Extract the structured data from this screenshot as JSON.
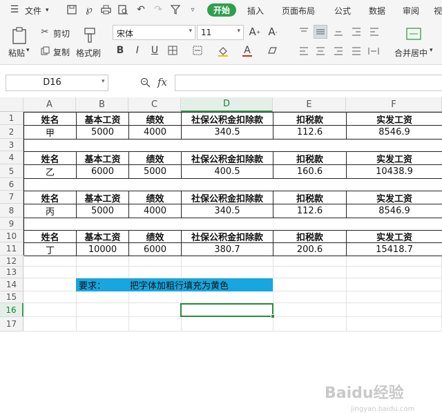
{
  "menu": {
    "file_label": "文件",
    "tabs": [
      "开始",
      "插入",
      "页面布局",
      "公式",
      "数据",
      "审阅",
      "视"
    ]
  },
  "ribbon": {
    "paste_label": "粘贴",
    "cut_label": "剪切",
    "copy_label": "复制",
    "format_painter_label": "格式刷",
    "font_name": "宋体",
    "font_size": "11",
    "merge_label": "合并居中"
  },
  "formula_bar": {
    "name_box": "D16",
    "fx_label": "fx",
    "formula": ""
  },
  "sheet": {
    "columns": [
      "A",
      "B",
      "C",
      "D",
      "E",
      "F"
    ],
    "selected_column": "D",
    "rows": [
      "1",
      "2",
      "3",
      "4",
      "5",
      "6",
      "7",
      "8",
      "9",
      "10",
      "11",
      "12",
      "13",
      "14",
      "15",
      "16",
      "17"
    ],
    "selected_row": "16",
    "blocks": [
      {
        "headers": [
          "姓名",
          "基本工资",
          "绩效",
          "社保公积金扣除款",
          "扣税款",
          "实发工资"
        ],
        "values": [
          "甲",
          "5000",
          "4000",
          "340.5",
          "112.6",
          "8546.9"
        ]
      },
      {
        "headers": [
          "姓名",
          "基本工资",
          "绩效",
          "社保公积金扣除款",
          "扣税款",
          "实发工资"
        ],
        "values": [
          "乙",
          "6000",
          "5000",
          "400.5",
          "160.6",
          "10438.9"
        ]
      },
      {
        "headers": [
          "姓名",
          "基本工资",
          "绩效",
          "社保公积金扣除款",
          "扣税款",
          "实发工资"
        ],
        "values": [
          "丙",
          "5000",
          "4000",
          "340.5",
          "112.6",
          "8546.9"
        ]
      },
      {
        "headers": [
          "姓名",
          "基本工资",
          "绩效",
          "社保公积金扣除款",
          "扣税款",
          "实发工资"
        ],
        "values": [
          "丁",
          "10000",
          "6000",
          "380.7",
          "200.6",
          "15418.7"
        ]
      }
    ],
    "requirement_label": "要求：",
    "requirement_text": "把字体加粗行填充为黄色",
    "requirement_fill": "#17a6df"
  },
  "watermark": {
    "text": "Baidu经验",
    "url": "jingyan.baidu.com"
  },
  "colors": {
    "accent": "#2f9f4e",
    "selection": "#2b8a3e"
  }
}
